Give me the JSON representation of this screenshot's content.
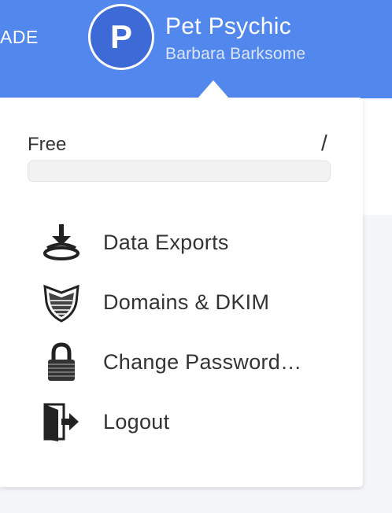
{
  "header": {
    "upgrade_label": "ADE",
    "avatar_letter": "P",
    "account_name": "Pet Psychic",
    "user_name": "Barbara Barksome"
  },
  "plan": {
    "label": "Free",
    "ratio": "/",
    "usage_fraction": 0
  },
  "menu": {
    "items": [
      {
        "label": "Data Exports",
        "icon": "download-icon"
      },
      {
        "label": "Domains & DKIM",
        "icon": "shield-icon"
      },
      {
        "label": "Change Password…",
        "icon": "lock-icon"
      },
      {
        "label": "Logout",
        "icon": "logout-icon"
      }
    ]
  },
  "colors": {
    "brand_blue": "#5287ee",
    "avatar_blue": "#3e6ad7",
    "text_dark": "#333333"
  }
}
